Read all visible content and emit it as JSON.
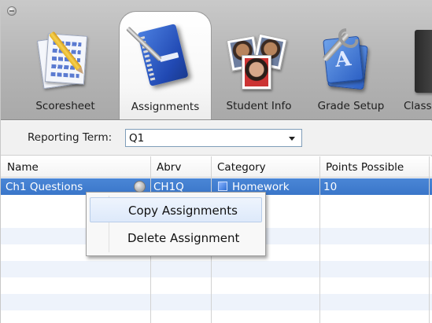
{
  "toolbar": {
    "tabs": [
      {
        "label": "Scoresheet",
        "icon": "scoresheet-icon"
      },
      {
        "label": "Assignments",
        "icon": "assignments-icon",
        "active": true
      },
      {
        "label": "Student Info",
        "icon": "student-info-icon"
      },
      {
        "label": "Grade Setup",
        "icon": "grade-setup-icon"
      },
      {
        "label": "Class",
        "icon": "class-icon"
      }
    ]
  },
  "term": {
    "label": "Reporting Term:",
    "value": "Q1"
  },
  "grid": {
    "columns": [
      "Name",
      "Abrv",
      "Category",
      "Points Possible"
    ],
    "rows": [
      {
        "name": "Ch1 Questions",
        "abrv": "CH1Q",
        "category": "Homework",
        "points": "10",
        "selected": true
      }
    ]
  },
  "context_menu": {
    "items": [
      "Copy Assignments",
      "Delete Assignment"
    ]
  },
  "colors": {
    "selection": "#3a76c9",
    "toolbar": "#b4b4b4"
  }
}
